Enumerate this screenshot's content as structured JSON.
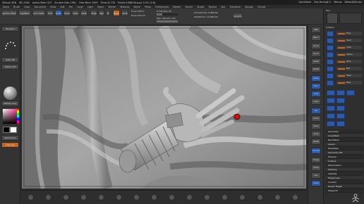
{
  "titlebar": {
    "app": "ZBrush 4R8",
    "items": [
      "ZB_2160",
      "Active Mem 327",
      "Scratch Disk 1961",
      "Free Mem 1909",
      "Timer 8.776",
      "Points 6.886 Mcount 1191 (2.8)"
    ],
    "quicksave": "QuickSave",
    "seethrough": "See-through 0",
    "menus": "Menus",
    "default_script": "DefaultZScript"
  },
  "menubar": {
    "items": [
      "Alpha",
      "Brush",
      "Color",
      "Document",
      "Draw",
      "Edit",
      "File",
      "Layer",
      "Light",
      "Macro",
      "Marker",
      "Material",
      "Movie",
      "Picker",
      "Preferences",
      "Render",
      "Stencil",
      "Stroke",
      "Texture",
      "Tool",
      "Transform",
      "Zplugin",
      "Zscript"
    ]
  },
  "shelf": {
    "projection_label": "Projection Master",
    "lightbox_label": "LightBox",
    "quick_sketch": "Quick Sketch",
    "edit": "Edit",
    "draw": "Draw",
    "move": "Move",
    "scale": "Scale",
    "rotate": "Rotate",
    "mrgb": "Mrgb",
    "rgb": "Rgb",
    "m": "M",
    "zadd": "Zadd",
    "zsub": "Zsub",
    "focal_shift": "Focal Shift 0",
    "draw_size": "Draw Size 64",
    "z_intensity": "Z Intensity 25",
    "rgb_intensity": "Rgb Intensity 100",
    "active_points": "ActivePoints: 6.886 Mil",
    "total_points": "TotalPoints: 14.685 Mil",
    "dynamic": "Dynamic",
    "z_intensity_level": 0.25,
    "rgb_intensity_level": 1.0
  },
  "left_panel": {
    "brush_label": "Standard",
    "alpha_label": "Alpha Off",
    "texture_label": "Texture Off",
    "material_label": "MatCap Gray",
    "gradient_label": "Gradient",
    "switch_color_label": "SwitchColor",
    "alternate_label": "Alternate"
  },
  "right_toolbar": {
    "buttons": [
      "BPR",
      "SPix 3",
      "Scroll",
      "Zoom",
      "Actual",
      "AAHalf",
      "Persp",
      "Floor",
      "Local",
      "L.Sym",
      "Xyz",
      "Frame",
      "Move",
      "Scale",
      "Rotate",
      "Line Fill",
      "Transp",
      "Ghost",
      "Solo",
      "Xpose"
    ]
  },
  "right_panel": {
    "title": "Tool",
    "subtool_title": "SubTool",
    "subtools": [
      "Body",
      "Hand",
      "Cloth",
      "Sleeve",
      "Robe",
      "Belt",
      "Head",
      "Base"
    ],
    "menu_items": [
      "Geometry",
      "ArrayMesh",
      "NanoMesh",
      "Layers",
      "FiberMesh",
      "Geometry HD",
      "Preview",
      "Surface",
      "Deformation",
      "Masking",
      "Visibility",
      "Polygroups",
      "Contact",
      "Morph Target",
      "Polypaint"
    ],
    "accent": "#2d5aa8",
    "orange": "#c8641e"
  }
}
